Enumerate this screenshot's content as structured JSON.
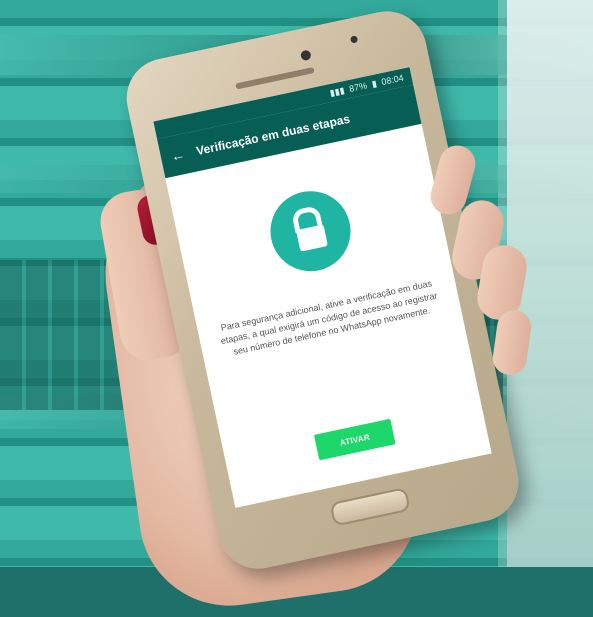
{
  "screen": {
    "status_bar": {
      "time": "08:04",
      "battery": "87%"
    },
    "app_bar": {
      "title": "Verificação em duas etapas"
    },
    "body_text": "Para segurança adicional, ative a verificação em duas etapas, a qual exigirá um código de acesso ao registrar seu número de telefone no WhatsApp novamente.",
    "button_label": "ATIVAR"
  }
}
